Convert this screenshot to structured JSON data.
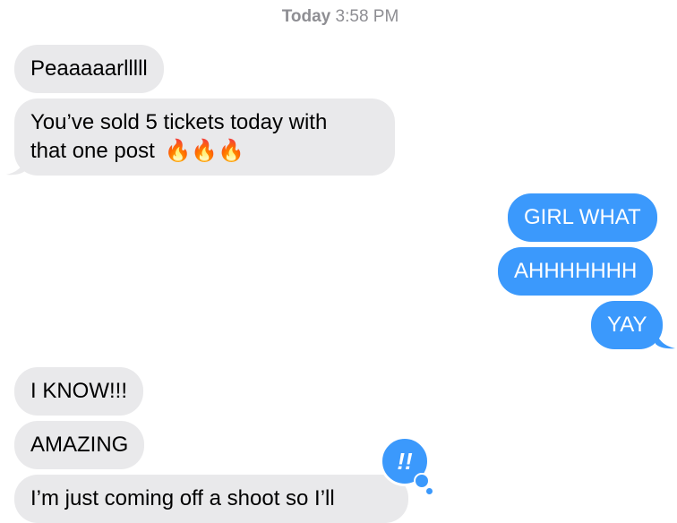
{
  "header": {
    "day": "Today",
    "time": "3:58 PM"
  },
  "messages": [
    {
      "sender": "them",
      "text": "Peaaaaarlllll"
    },
    {
      "sender": "them",
      "line1": "You’ve sold 5 tickets today with",
      "line2": "that one post",
      "emoji": "🔥🔥🔥"
    },
    {
      "sender": "me",
      "text": "GIRL WHAT"
    },
    {
      "sender": "me",
      "text": "AHHHHHHH"
    },
    {
      "sender": "me",
      "text": "YAY"
    },
    {
      "sender": "them",
      "text": "I KNOW!!!"
    },
    {
      "sender": "them",
      "text": "AMAZING"
    },
    {
      "sender": "them",
      "text": "I’m just coming off a shoot so I’ll"
    }
  ],
  "tapback": {
    "icon": "double-exclamation-icon",
    "glyph": "!!"
  },
  "colors": {
    "sent_bubble": "#3b99fc",
    "received_bubble": "#e9e9eb",
    "timestamp": "#8e8e93"
  }
}
